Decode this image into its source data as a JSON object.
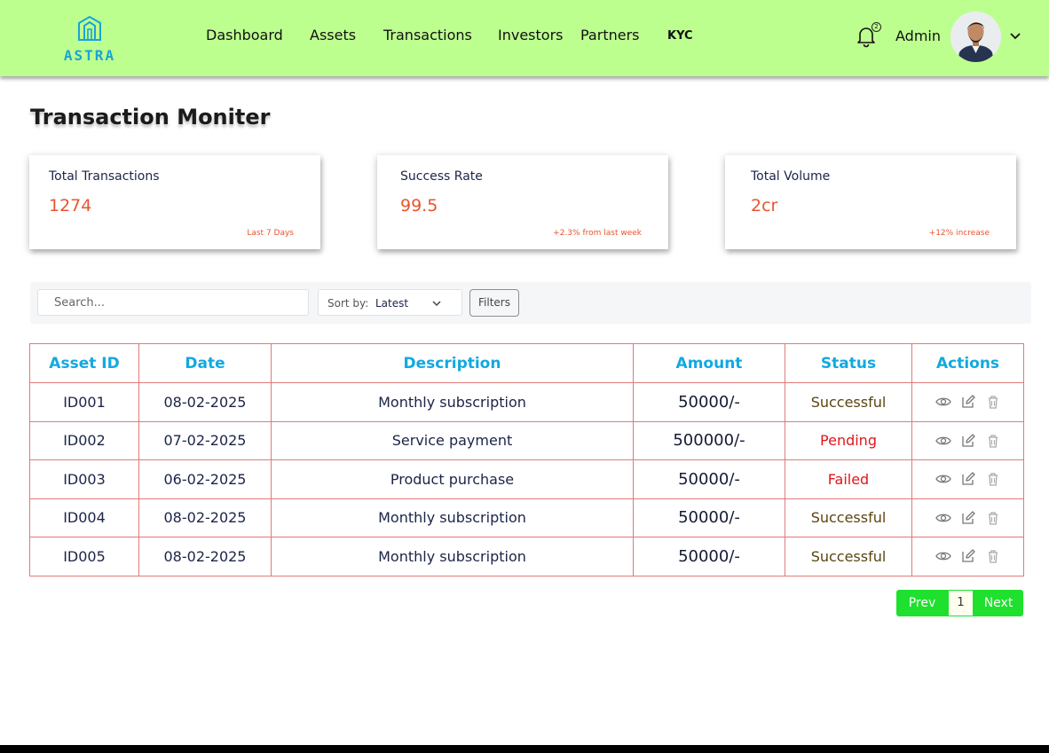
{
  "brand": {
    "name": "ASTRA",
    "accent": "#1aa3d6",
    "header_bg": "#bdff8f"
  },
  "nav": {
    "items": [
      {
        "label": "Dashboard"
      },
      {
        "label": "Assets"
      },
      {
        "label": "Transactions"
      },
      {
        "label": "Investors"
      },
      {
        "label": "Partners"
      },
      {
        "label": "KYC"
      }
    ]
  },
  "header": {
    "notification_count": "2",
    "notification_icon": "bell-icon",
    "user_name": "Admin",
    "menu_icon": "chevron-down-icon"
  },
  "page": {
    "title": "Transaction Moniter"
  },
  "stats": [
    {
      "label": "Total Transactions",
      "value": "1274",
      "note": "Last 7 Days"
    },
    {
      "label": "Success Rate",
      "value": "99.5",
      "note": "+2.3% from last week"
    },
    {
      "label": "Total Volume",
      "value": "2cr",
      "note": "+12% increase"
    }
  ],
  "toolbar": {
    "search_placeholder": "Search...",
    "sort_label": "Sort by:",
    "sort_value": "Latest",
    "filters_label": "Filters"
  },
  "table": {
    "columns": [
      "Asset ID",
      "Date",
      "Description",
      "Amount",
      "Status",
      "Actions"
    ],
    "rows": [
      {
        "id": "ID001",
        "date": "08-02-2025",
        "description": "Monthly subscription",
        "amount": "50000/-",
        "status": "Successful"
      },
      {
        "id": "ID002",
        "date": "07-02-2025",
        "description": "Service payment",
        "amount": "500000/-",
        "status": "Pending"
      },
      {
        "id": "ID003",
        "date": "06-02-2025",
        "description": "Product purchase",
        "amount": "50000/-",
        "status": "Failed"
      },
      {
        "id": "ID004",
        "date": "08-02-2025",
        "description": "Monthly subscription",
        "amount": "50000/-",
        "status": "Successful"
      },
      {
        "id": "ID005",
        "date": "08-02-2025",
        "description": "Monthly subscription",
        "amount": "50000/-",
        "status": "Successful"
      }
    ],
    "action_icons": [
      "eye-icon",
      "edit-icon",
      "trash-icon"
    ],
    "status_colors": {
      "Successful": "#5a4510",
      "Pending": "#e0161b",
      "Failed": "#e0161b"
    }
  },
  "pagination": {
    "prev_label": "Prev",
    "current_page": "1",
    "next_label": "Next",
    "accent": "#1fe02e"
  }
}
